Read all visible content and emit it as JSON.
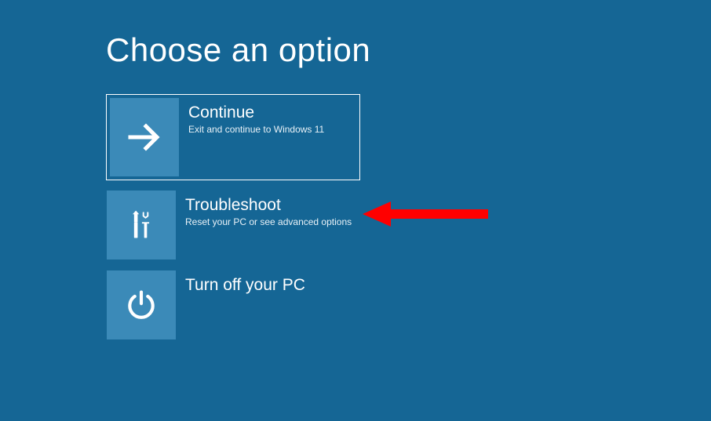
{
  "page": {
    "title": "Choose an option"
  },
  "options": [
    {
      "id": "continue",
      "title": "Continue",
      "description": "Exit and continue to Windows 11",
      "icon": "arrow-right",
      "selected": true
    },
    {
      "id": "troubleshoot",
      "title": "Troubleshoot",
      "description": "Reset your PC or see advanced options",
      "icon": "tools",
      "selected": false
    },
    {
      "id": "turnoff",
      "title": "Turn off your PC",
      "description": "",
      "icon": "power",
      "selected": false
    }
  ]
}
